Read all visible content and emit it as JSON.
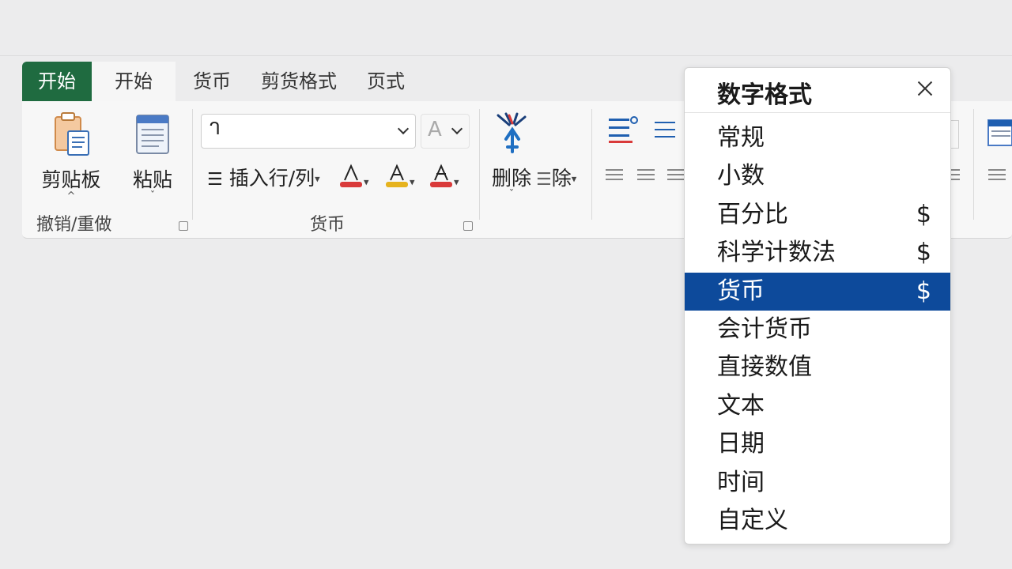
{
  "ribbon": {
    "tabs": [
      "开始",
      "开始",
      "货币",
      "剪货格式",
      "页式"
    ],
    "groups": {
      "clipboard": {
        "label": "撤销/重做",
        "clipboard_btn": "剪贴板",
        "paste_btn": "粘贴",
        "clipboard_caret": "^",
        "paste_caret": "ˇ"
      },
      "currency": {
        "label": "货币",
        "font_box_value": "ᒉ",
        "insert_row_col": "插入行/列",
        "letter_a": "A"
      },
      "delete": {
        "delete_btn": "删除",
        "delete_small": "除",
        "caret": "ˇ"
      }
    }
  },
  "number_format_panel": {
    "title": "数字格式",
    "items": [
      {
        "label": "常规",
        "symbol": ""
      },
      {
        "label": "小数",
        "symbol": ""
      },
      {
        "label": "百分比",
        "symbol": "$"
      },
      {
        "label": "科学计数法",
        "symbol": "$"
      },
      {
        "label": "货币",
        "symbol": "$"
      },
      {
        "label": "会计货币",
        "symbol": ""
      },
      {
        "label": "直接数值",
        "symbol": ""
      },
      {
        "label": "文本",
        "symbol": ""
      },
      {
        "label": "日期",
        "symbol": ""
      },
      {
        "label": "时间",
        "symbol": ""
      },
      {
        "label": "自定义",
        "symbol": ""
      }
    ],
    "selected_index": 4
  },
  "colors": {
    "file_tab": "#1f6b40",
    "selection": "#0d4a9b",
    "font_color_red": "#d93a3a",
    "font_color_yellow": "#e6b31e"
  }
}
